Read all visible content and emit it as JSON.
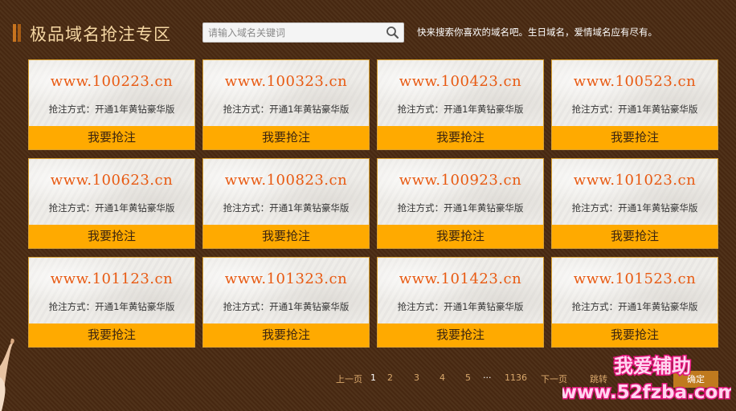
{
  "header": {
    "title": "极品域名抢注专区",
    "search_placeholder": "请输入域名关键词",
    "tagline": "快来搜索你喜欢的域名吧。生日域名，爱情域名应有尽有。"
  },
  "cards": [
    {
      "domain": "www.100223.cn",
      "method": "抢注方式：开通1年黄钻豪华版",
      "button": "我要抢注"
    },
    {
      "domain": "www.100323.cn",
      "method": "抢注方式：开通1年黄钻豪华版",
      "button": "我要抢注"
    },
    {
      "domain": "www.100423.cn",
      "method": "抢注方式：开通1年黄钻豪华版",
      "button": "我要抢注"
    },
    {
      "domain": "www.100523.cn",
      "method": "抢注方式：开通1年黄钻豪华版",
      "button": "我要抢注"
    },
    {
      "domain": "www.100623.cn",
      "method": "抢注方式：开通1年黄钻豪华版",
      "button": "我要抢注"
    },
    {
      "domain": "www.100823.cn",
      "method": "抢注方式：开通1年黄钻豪华版",
      "button": "我要抢注"
    },
    {
      "domain": "www.100923.cn",
      "method": "抢注方式：开通1年黄钻豪华版",
      "button": "我要抢注"
    },
    {
      "domain": "www.101023.cn",
      "method": "抢注方式：开通1年黄钻豪华版",
      "button": "我要抢注"
    },
    {
      "domain": "www.101123.cn",
      "method": "抢注方式：开通1年黄钻豪华版",
      "button": "我要抢注"
    },
    {
      "domain": "www.101323.cn",
      "method": "抢注方式：开通1年黄钻豪华版",
      "button": "我要抢注"
    },
    {
      "domain": "www.101423.cn",
      "method": "抢注方式：开通1年黄钻豪华版",
      "button": "我要抢注"
    },
    {
      "domain": "www.101523.cn",
      "method": "抢注方式：开通1年黄钻豪华版",
      "button": "我要抢注"
    }
  ],
  "pagination": {
    "prev": "上一页",
    "pages": [
      "1",
      "2",
      "3",
      "4",
      "5"
    ],
    "current": "1",
    "ellipsis": "···",
    "last_page": "1136",
    "next": "下一页",
    "jump": "跳转",
    "confirm": "确定"
  },
  "watermark": {
    "line1": "我爱辅助",
    "line2": "www.52fzba.com"
  },
  "colors": {
    "background": "#4a2a12",
    "title": "#f5d7a3",
    "domain_text": "#e85a12",
    "button": "#ffaa00",
    "card_border": "#d9a030",
    "pagination_text": "#d9a86c"
  },
  "icons": [
    "search-icon"
  ]
}
